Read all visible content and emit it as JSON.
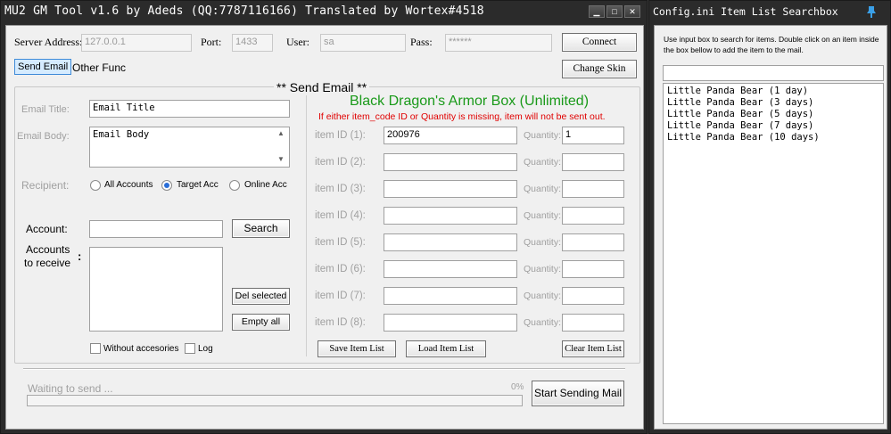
{
  "main_window": {
    "title": "MU2 GM Tool v1.6 by Adeds (QQ:7787116166) Translated by Wortex#4518",
    "controls": {
      "minimize": "▁",
      "maximize": "□",
      "close": "✕"
    }
  },
  "connection": {
    "server_label": "Server Address:",
    "server_value": "127.0.0.1",
    "port_label": "Port:",
    "port_value": "1433",
    "user_label": "User:",
    "user_value": "sa",
    "pass_label": "Pass:",
    "pass_value": "******",
    "connect_label": "Connect",
    "change_skin_label": "Change Skin"
  },
  "tabs": [
    {
      "label": "Send Email",
      "active": true
    },
    {
      "label": "Other Func",
      "active": false
    }
  ],
  "email": {
    "group_title": "** Send Email **",
    "title_label": "Email Title:",
    "title_value": "Email Title",
    "body_label": "Email Body:",
    "body_value": "Email Body",
    "recipient_label": "Recipient:",
    "recipient_options": [
      {
        "label": "All Accounts",
        "selected": false
      },
      {
        "label": "Target Acc",
        "selected": true
      },
      {
        "label": "Online Acc",
        "selected": false
      }
    ],
    "account_label": "Account:",
    "account_value": "",
    "search_label": "Search",
    "accounts_receive_label_1": "Accounts",
    "accounts_receive_label_2": "to receive",
    "accounts_receive_colon": ":",
    "del_selected_label": "Del selected",
    "empty_all_label": "Empty all",
    "without_accessories_label": "Without accesories",
    "log_label": "Log"
  },
  "items": {
    "selected_item_name": "Black Dragon's Armor Box (Unlimited)",
    "warning": "If either item_code ID or Quantity is missing, item will not be sent out.",
    "quantity_label": "Quantity:",
    "rows": [
      {
        "label": "item ID  (1):",
        "id": "200976",
        "quantity": "1"
      },
      {
        "label": "item ID  (2):",
        "id": "",
        "quantity": ""
      },
      {
        "label": "item ID  (3):",
        "id": "",
        "quantity": ""
      },
      {
        "label": "item ID  (4):",
        "id": "",
        "quantity": ""
      },
      {
        "label": "item ID  (5):",
        "id": "",
        "quantity": ""
      },
      {
        "label": "item ID  (6):",
        "id": "",
        "quantity": ""
      },
      {
        "label": "item ID  (7):",
        "id": "",
        "quantity": ""
      },
      {
        "label": "item ID  (8):",
        "id": "",
        "quantity": ""
      }
    ],
    "save_list_label": "Save Item List",
    "load_list_label": "Load Item List",
    "clear_list_label": "Clear Item List"
  },
  "status": {
    "text": "Waiting to send ...",
    "percent_text": "0%",
    "progress": 0,
    "start_label": "Start Sending Mail"
  },
  "side_window": {
    "title": "Config.ini Item List Searchbox",
    "instructions": "Use input box to search for items. Double click on an item inside the box bellow to add the item to the mail.",
    "search_value": "",
    "items": [
      "Little Panda Bear  (1 day)",
      "Little Panda Bear  (3 days)",
      "Little Panda Bear  (5 days)",
      "Little Panda Bear  (7 days)",
      "Little Panda Bear  (10 days)"
    ]
  },
  "colors": {
    "item_name": "#1a9a1a",
    "warning": "#e00000",
    "disabled_label": "#a0a0a0",
    "pin_icon": "#3aa0e8"
  }
}
